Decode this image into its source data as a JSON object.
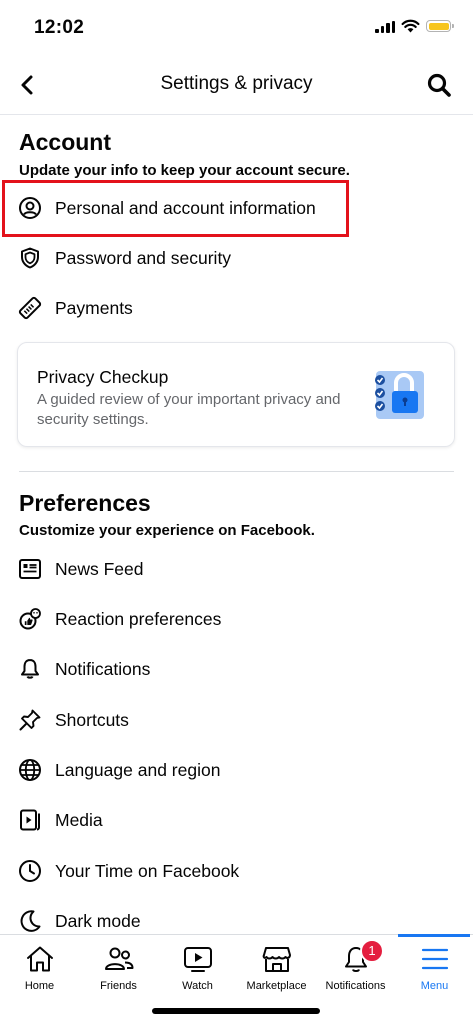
{
  "status": {
    "time": "12:02"
  },
  "nav": {
    "title": "Settings & privacy"
  },
  "account": {
    "title": "Account",
    "subtitle": "Update your info to keep your account secure.",
    "items": [
      {
        "label": "Personal and account information",
        "icon": "person-circle-icon"
      },
      {
        "label": "Password and security",
        "icon": "shield-icon"
      },
      {
        "label": "Payments",
        "icon": "tag-icon"
      }
    ]
  },
  "privacy_card": {
    "title": "Privacy Checkup",
    "description": "A guided review of your important privacy and security settings.",
    "icon": "padlock-checklist-icon"
  },
  "preferences": {
    "title": "Preferences",
    "subtitle": "Customize your experience on Facebook.",
    "items": [
      {
        "label": "News Feed",
        "icon": "news-feed-icon"
      },
      {
        "label": "Reaction preferences",
        "icon": "reaction-icon"
      },
      {
        "label": "Notifications",
        "icon": "bell-icon"
      },
      {
        "label": "Shortcuts",
        "icon": "pin-icon"
      },
      {
        "label": "Language and region",
        "icon": "globe-icon"
      },
      {
        "label": "Media",
        "icon": "media-icon"
      },
      {
        "label": "Your Time on Facebook",
        "icon": "clock-icon"
      },
      {
        "label": "Dark mode",
        "icon": "moon-icon"
      }
    ]
  },
  "tabs": [
    {
      "label": "Home",
      "icon": "home-icon"
    },
    {
      "label": "Friends",
      "icon": "friends-icon"
    },
    {
      "label": "Watch",
      "icon": "watch-icon"
    },
    {
      "label": "Marketplace",
      "icon": "marketplace-icon"
    },
    {
      "label": "Notifications",
      "icon": "bell-icon",
      "badge": "1"
    },
    {
      "label": "Menu",
      "icon": "menu-icon",
      "active": true
    }
  ],
  "colors": {
    "accent": "#1877f2",
    "highlight": "#e3121b",
    "badge": "#e41e3f",
    "battery": "#f7c51e"
  }
}
